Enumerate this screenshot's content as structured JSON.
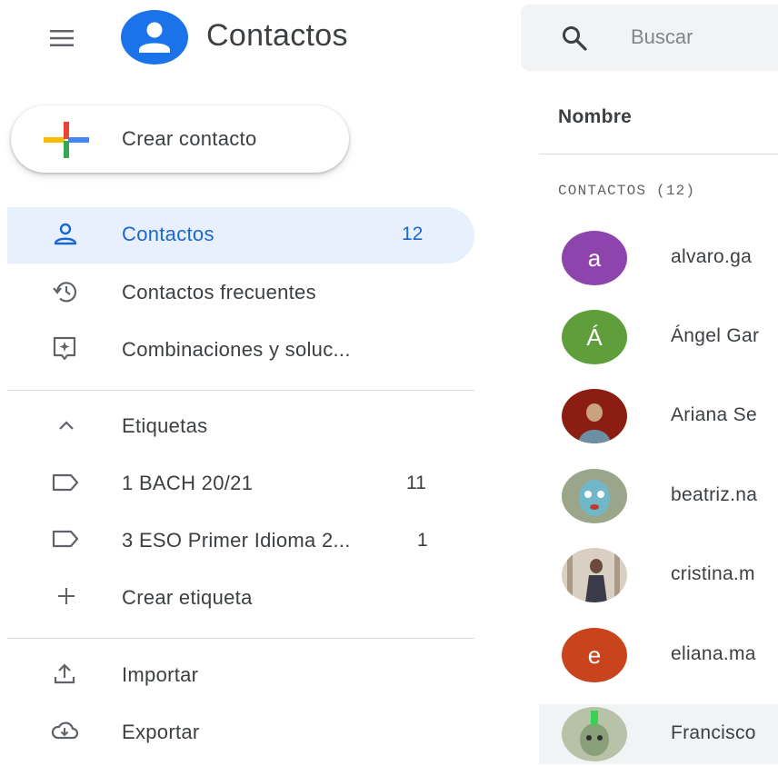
{
  "header": {
    "app_title": "Contactos",
    "search_placeholder": "Buscar"
  },
  "sidebar": {
    "create_label": "Crear contacto",
    "items": [
      {
        "label": "Contactos",
        "count": "12",
        "icon": "person-icon"
      },
      {
        "label": "Contactos frecuentes",
        "count": "",
        "icon": "history-icon"
      },
      {
        "label": "Combinaciones y soluc...",
        "count": "",
        "icon": "merge-fix-icon"
      }
    ],
    "labels_header": "Etiquetas",
    "labels": [
      {
        "label": "1 BACH 20/21",
        "count": "11"
      },
      {
        "label": "3 ESO Primer Idioma 2...",
        "count": "1"
      }
    ],
    "create_label_item": "Crear etiqueta",
    "import_label": "Importar",
    "export_label": "Exportar"
  },
  "list": {
    "column_header": "Nombre",
    "section_title": "CONTACTOS (12)",
    "contacts": [
      {
        "name": "alvaro.ga",
        "initial": "a",
        "color": "#8e44ad"
      },
      {
        "name": "Ángel Gar",
        "initial": "Á",
        "color": "#5f9e3b"
      },
      {
        "name": "Ariana Se",
        "initial": "",
        "color": "#8b1d12"
      },
      {
        "name": "beatriz.na",
        "initial": "",
        "color": "#7e8c7c"
      },
      {
        "name": "cristina.m",
        "initial": "",
        "color": "#b7a894"
      },
      {
        "name": "eliana.ma",
        "initial": "e",
        "color": "#c9431c"
      },
      {
        "name": "Francisco",
        "initial": "",
        "color": "#8aa07a"
      }
    ]
  },
  "colors": {
    "accent": "#1a73e8",
    "active_bg": "#e8f0fe",
    "active_text": "#1967d2"
  }
}
